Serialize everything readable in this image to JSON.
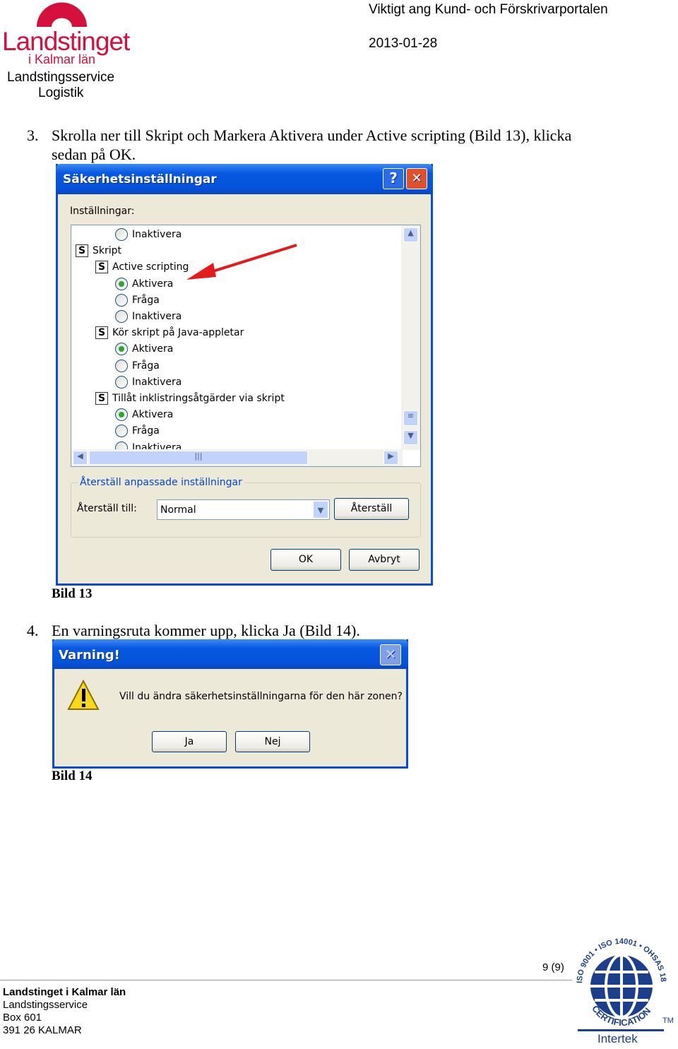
{
  "header": {
    "logo_name": "Landstinget",
    "logo_sub": "i Kalmar län",
    "dept": "Landstingsservice",
    "unit": "Logistik",
    "doc_title": "Viktigt ang Kund- och Förskrivarportalen",
    "date": "2013-01-28"
  },
  "steps": [
    {
      "num": "3.",
      "text_line1": "Skrolla ner till Skript och Markera Aktivera under Active scripting (Bild 13), klicka",
      "text_line2": "sedan på OK.",
      "caption": "Bild 13"
    },
    {
      "num": "4.",
      "text": "En varningsruta kommer upp, klicka Ja (Bild 14).",
      "caption": "Bild 14"
    }
  ],
  "dialog1": {
    "title": "Säkerhetsinställningar",
    "help": "?",
    "close": "✕",
    "settings_label": "Inställningar:",
    "items": [
      {
        "type": "radio",
        "label": "Inaktivera",
        "checked": false,
        "level": 2
      },
      {
        "type": "group",
        "label": "Skript",
        "level": 0
      },
      {
        "type": "group",
        "label": "Active scripting",
        "level": 1
      },
      {
        "type": "radio",
        "label": "Aktivera",
        "checked": true,
        "level": 2
      },
      {
        "type": "radio",
        "label": "Fråga",
        "checked": false,
        "level": 2
      },
      {
        "type": "radio",
        "label": "Inaktivera",
        "checked": false,
        "level": 2
      },
      {
        "type": "group",
        "label": "Kör skript på Java-appletar",
        "level": 1
      },
      {
        "type": "radio",
        "label": "Aktivera",
        "checked": true,
        "level": 2
      },
      {
        "type": "radio",
        "label": "Fråga",
        "checked": false,
        "level": 2
      },
      {
        "type": "radio",
        "label": "Inaktivera",
        "checked": false,
        "level": 2
      },
      {
        "type": "group",
        "label": "Tillåt inklistringsåtgärder via skript",
        "level": 1
      },
      {
        "type": "radio",
        "label": "Aktivera",
        "checked": true,
        "level": 2
      },
      {
        "type": "radio",
        "label": "Fråga",
        "checked": false,
        "level": 2
      },
      {
        "type": "radio",
        "label": "Inaktivera",
        "checked": false,
        "level": 2
      }
    ],
    "reset_group": "Återställ anpassade inställningar",
    "reset_to_label": "Återställ till:",
    "reset_value": "Normal",
    "reset_button": "Återställ",
    "ok": "OK",
    "cancel": "Avbryt"
  },
  "dialog2": {
    "title": "Varning!",
    "message": "Vill du ändra säkerhetsinställningarna för den här zonen?",
    "yes": "Ja",
    "no": "Nej"
  },
  "footer": {
    "page": "9 (9)",
    "org": "Landstinget i Kalmar län",
    "dept": "Landstingsservice",
    "box": "Box 601",
    "city": "391 26 KALMAR",
    "cert_ring": "ISO 9001 • ISO 14001 • OHSAS 18001",
    "cert_bottom": "CERTIFICATION",
    "tm": "TM",
    "cert_company": "Intertek"
  },
  "colors": {
    "brand_red": "#D6103C",
    "xp_blue": "#0A4CD6",
    "cert_blue": "#1B3F8B"
  }
}
